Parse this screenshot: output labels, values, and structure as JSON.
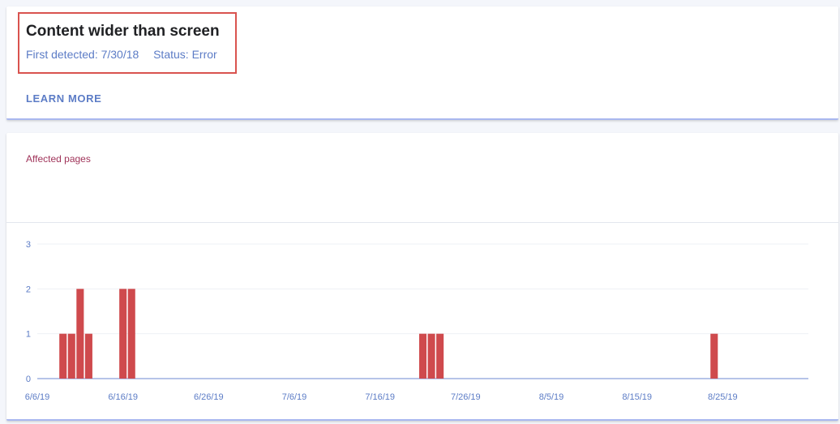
{
  "issue": {
    "title": "Content wider than screen",
    "first_detected_label": "First detected:",
    "first_detected_value": "7/30/18",
    "status_label": "Status:",
    "status_value": "Error",
    "learn_more": "LEARN MORE"
  },
  "colors": {
    "bar": "#cf4a4d",
    "accent": "#5c7cc6",
    "highlight": "#d9534f",
    "heading": "#a0345a"
  },
  "chart_data": {
    "type": "bar",
    "title": "Affected pages",
    "ylim": [
      0,
      3
    ],
    "yticks": [
      0,
      1,
      2,
      3
    ],
    "x_ticks": [
      "6/6/19",
      "6/16/19",
      "6/26/19",
      "7/6/19",
      "7/16/19",
      "7/26/19",
      "8/5/19",
      "8/15/19",
      "8/25/19"
    ],
    "x_range": [
      "6/6/19",
      "9/4/19"
    ],
    "grid": true,
    "series": [
      {
        "x": [
          "6/9/19",
          "6/10/19",
          "6/11/19",
          "6/12/19",
          "6/16/19",
          "6/17/19",
          "7/21/19",
          "7/22/19",
          "7/23/19",
          "8/24/19"
        ],
        "values": [
          1,
          1,
          2,
          1,
          2,
          2,
          1,
          1,
          1,
          1
        ]
      }
    ]
  }
}
